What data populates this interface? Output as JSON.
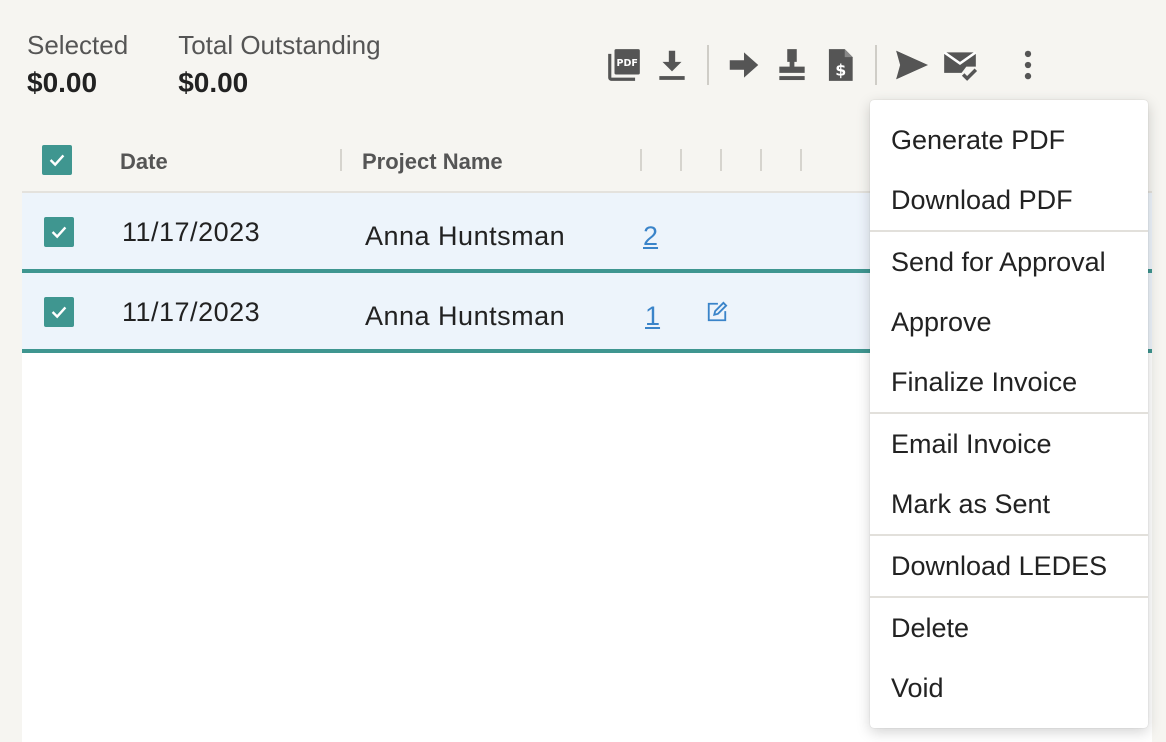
{
  "summary": {
    "selected_label": "Selected",
    "selected_value": "$0.00",
    "outstanding_label": "Total Outstanding",
    "outstanding_value": "$0.00"
  },
  "toolbar": {
    "icons": [
      "pdf-icon",
      "download-icon",
      "arrow-right-icon",
      "stamp-icon",
      "invoice-dollar-icon",
      "send-icon",
      "mail-check-icon",
      "more-vertical-icon"
    ]
  },
  "table": {
    "columns": {
      "date": "Date",
      "project": "Project Name"
    },
    "rows": [
      {
        "date": "11/17/2023",
        "project": "Anna Huntsman",
        "count": "2",
        "has_edit": false
      },
      {
        "date": "11/17/2023",
        "project": "Anna Huntsman",
        "count": "1",
        "has_edit": true
      }
    ]
  },
  "menu": {
    "items": [
      "Generate PDF",
      "Download PDF",
      "Send for Approval",
      "Approve",
      "Finalize Invoice",
      "Email Invoice",
      "Mark as Sent",
      "Download LEDES",
      "Delete",
      "Void"
    ]
  },
  "colors": {
    "accent": "#3f9690",
    "link": "#3a84c9",
    "row_selected_bg": "#edf4fb",
    "icon": "#555555"
  }
}
